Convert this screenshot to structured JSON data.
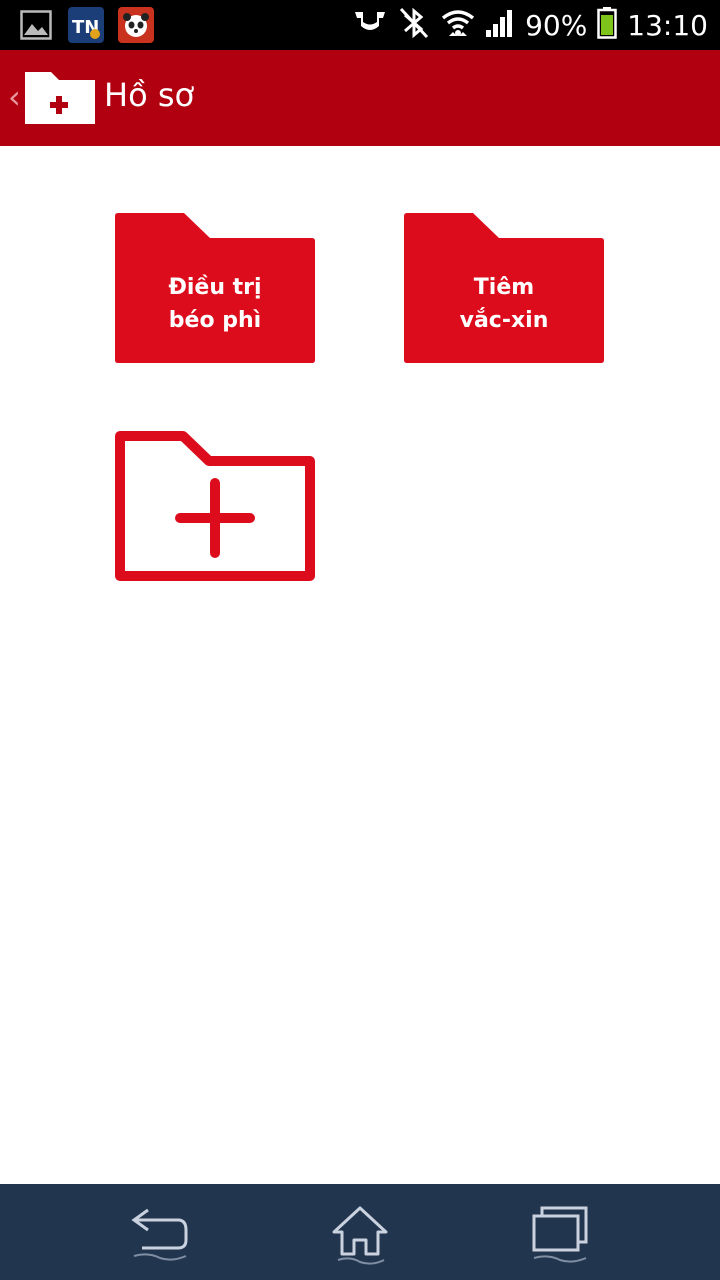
{
  "status_bar": {
    "battery": "90%",
    "time": "13:10",
    "icons": [
      "gallery-icon",
      "tn-app-icon",
      "panda-app-icon",
      "cast-icon",
      "bluetooth-off-icon",
      "wifi-icon",
      "signal-icon",
      "battery-icon"
    ]
  },
  "header": {
    "back_symbol": "‹",
    "title": "Hồ sơ",
    "icon": "medical-folder-icon"
  },
  "folders": [
    {
      "line1": "Điều trị",
      "line2": "béo phì"
    },
    {
      "line1": "Tiêm",
      "line2": "vắc-xin"
    }
  ],
  "add_folder": {
    "icon": "add-folder-icon"
  },
  "nav": {
    "icons": [
      "back-nav-icon",
      "home-nav-icon",
      "recent-apps-icon"
    ]
  },
  "colors": {
    "status_bar": "#000000",
    "app_bar": "#b10010",
    "folder_red": "#dc0c1c",
    "nav_bar": "#22354f"
  }
}
